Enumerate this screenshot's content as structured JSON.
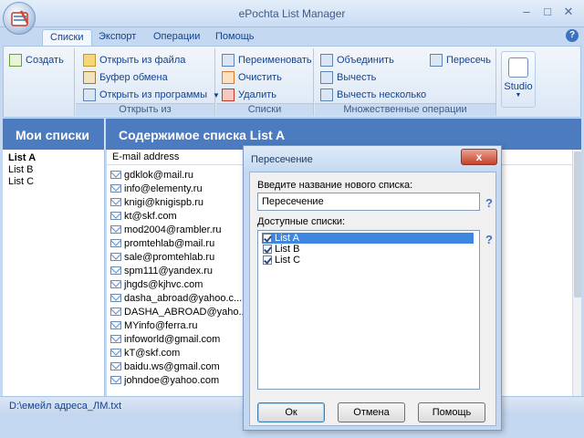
{
  "window": {
    "title": "ePochta List Manager"
  },
  "tabs": [
    "Списки",
    "Экспорт",
    "Операции",
    "Помощь"
  ],
  "ribbon": {
    "create": "Создать",
    "open_group": {
      "items": [
        "Открыть из файла",
        "Буфер обмена",
        "Открыть из программы"
      ],
      "label": "Открыть из"
    },
    "lists_group": {
      "items": [
        "Переименовать",
        "Очистить",
        "Удалить"
      ],
      "label": "Списки"
    },
    "ops_group": {
      "items": [
        "Объединить",
        "Вычесть",
        "Вычесть несколько",
        "Пересечь"
      ],
      "label": "Множественные операции"
    },
    "studio": "Studio"
  },
  "left": {
    "title": "Мои списки",
    "lists": [
      "List A",
      "List B",
      "List C"
    ]
  },
  "content": {
    "title": "Содержимое списка List A",
    "column": "E-mail address",
    "emails": [
      "gdklok@mail.ru",
      "info@elementy.ru",
      "knigi@knigispb.ru",
      "kt@skf.com",
      "mod2004@rambler.ru",
      "promtehlab@mail.ru",
      "sale@promtehlab.ru",
      "spm111@yandex.ru",
      "jhgds@kjhvc.com",
      "dasha_abroad@yahoo.c...",
      "DASHA_ABROAD@yaho...",
      "MYinfo@ferra.ru",
      "infoworld@gmail.com",
      "kT@skf.com",
      "baidu.ws@gmail.com",
      "johndoe@yahoo.com"
    ]
  },
  "status": {
    "path": "D:\\емейл адреса_ЛМ.txt"
  },
  "dialog": {
    "title": "Пересечение",
    "close": "x",
    "name_label": "Введите название нового списка:",
    "name_value": "Пересечение",
    "help": "?",
    "available_label": "Доступные списки:",
    "lists": [
      "List A",
      "List B",
      "List C"
    ],
    "ok": "Ок",
    "cancel": "Отмена",
    "help_btn": "Помощь"
  },
  "colors": {
    "accent": "#4c7cbf",
    "ribbon": "#c4d9f1",
    "selection": "#3f86e0"
  }
}
